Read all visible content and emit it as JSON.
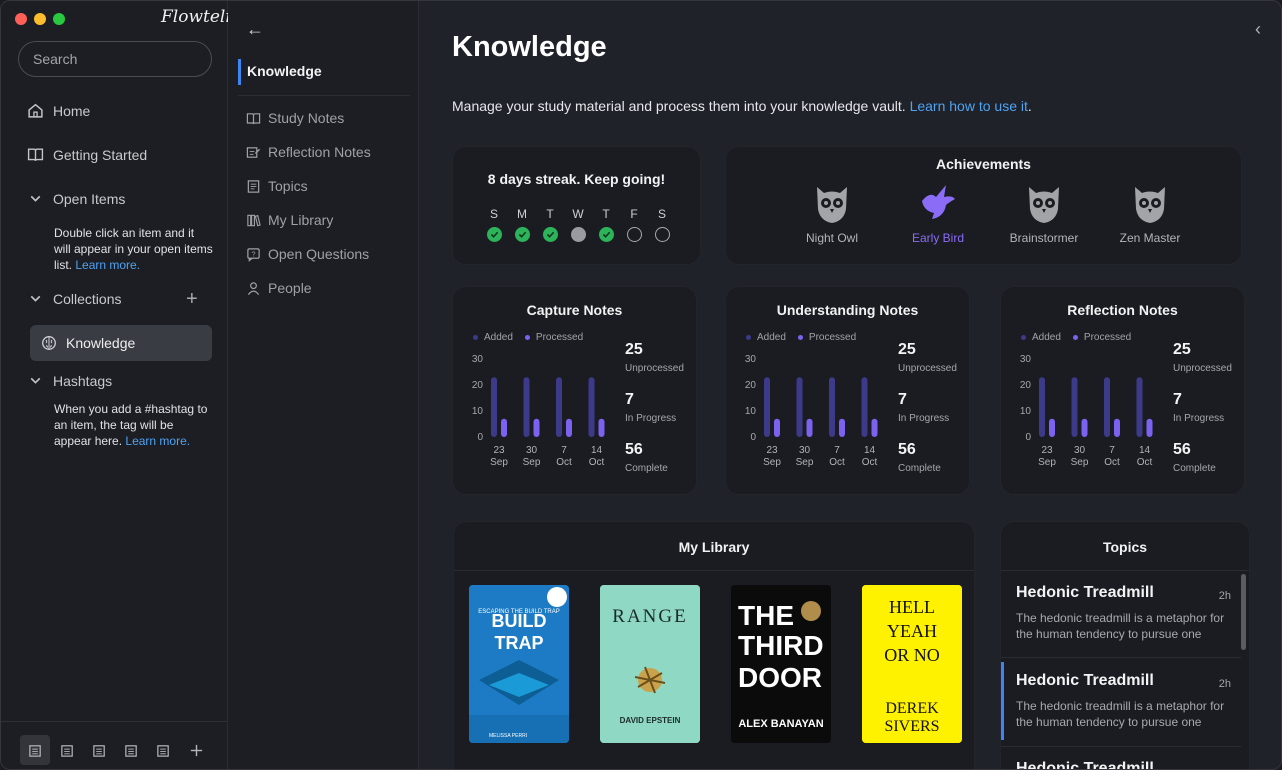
{
  "sidebar": {
    "logo": "Flowtelic",
    "search_placeholder": "Search",
    "items": {
      "home": "Home",
      "getting_started": "Getting Started",
      "open_items": "Open Items",
      "collections": "Collections",
      "knowledge": "Knowledge",
      "hashtags": "Hashtags"
    },
    "open_items_note": "Double click an item and it will appear in your open items list.",
    "hashtags_note": "When you add a #hashtag to an item, the tag will be appear here.",
    "learn_more": "Learn more.",
    "traffic_colors": [
      "#fe5f57",
      "#febc2e",
      "#28c840"
    ]
  },
  "subnav": {
    "active": "Knowledge",
    "items": [
      "Study Notes",
      "Reflection Notes",
      "Topics",
      "My Library",
      "Open Questions",
      "People"
    ]
  },
  "main": {
    "title": "Knowledge",
    "description": "Manage your study material and process them into your knowledge vault. ",
    "learn_link": "Learn how to use it",
    "period": ".",
    "streak": {
      "title": "8 days streak. Keep going!",
      "days": [
        {
          "label": "S",
          "state": "done"
        },
        {
          "label": "M",
          "state": "done"
        },
        {
          "label": "T",
          "state": "done"
        },
        {
          "label": "W",
          "state": "missed"
        },
        {
          "label": "T",
          "state": "done"
        },
        {
          "label": "F",
          "state": "empty"
        },
        {
          "label": "S",
          "state": "empty"
        }
      ]
    },
    "achievements": {
      "title": "Achievements",
      "items": [
        {
          "label": "Night Owl",
          "active": false
        },
        {
          "label": "Early Bird",
          "active": true
        },
        {
          "label": "Brainstormer",
          "active": false
        },
        {
          "label": "Zen Master",
          "active": false
        }
      ]
    },
    "library": {
      "title": "My Library",
      "books": [
        {
          "title": "ESCAPING THE BUILD TRAP",
          "author": "MELISSA PERRI",
          "color": "#1f7fc6"
        },
        {
          "title": "RANGE",
          "author": "DAVID EPSTEIN",
          "color": "#8ed8c4"
        },
        {
          "title": "THE THIRD DOOR",
          "author": "ALEX BANAYAN",
          "color": "#0b0b0b"
        },
        {
          "title": "HELL YEAH OR NO",
          "author": "DEREK SIVERS",
          "color": "#fff200"
        }
      ]
    },
    "topics": {
      "title": "Topics",
      "items": [
        {
          "title": "Hedonic Treadmill",
          "time": "2h",
          "desc": "The hedonic treadmill is a metaphor for the human tendency to pursue one"
        },
        {
          "title": "Hedonic Treadmill",
          "time": "2h",
          "desc": "The hedonic treadmill is a metaphor for the human tendency to pursue one"
        },
        {
          "title": "Hedonic Treadmill",
          "time": "",
          "desc": ""
        }
      ]
    }
  },
  "chart_data": [
    {
      "type": "bar",
      "title": "Capture Notes",
      "categories": [
        "23 Sep",
        "30 Sep",
        "7 Oct",
        "14 Oct"
      ],
      "series": [
        {
          "name": "Added",
          "values": [
            23,
            23,
            23,
            23
          ]
        },
        {
          "name": "Processed",
          "values": [
            7,
            7,
            7,
            7
          ]
        }
      ],
      "ylim": [
        0,
        30
      ],
      "yticks": [
        0,
        10,
        20,
        30
      ],
      "stats": [
        {
          "value": "25",
          "label": "Unprocessed"
        },
        {
          "value": "7",
          "label": "In Progress"
        },
        {
          "value": "56",
          "label": "Complete"
        }
      ]
    },
    {
      "type": "bar",
      "title": "Understanding Notes",
      "categories": [
        "23 Sep",
        "30 Sep",
        "7 Oct",
        "14 Oct"
      ],
      "series": [
        {
          "name": "Added",
          "values": [
            23,
            23,
            23,
            23
          ]
        },
        {
          "name": "Processed",
          "values": [
            7,
            7,
            7,
            7
          ]
        }
      ],
      "ylim": [
        0,
        30
      ],
      "yticks": [
        0,
        10,
        20,
        30
      ],
      "stats": [
        {
          "value": "25",
          "label": "Unprocessed"
        },
        {
          "value": "7",
          "label": "In Progress"
        },
        {
          "value": "56",
          "label": "Complete"
        }
      ]
    },
    {
      "type": "bar",
      "title": "Reflection Notes",
      "categories": [
        "23 Sep",
        "30 Sep",
        "7 Oct",
        "14 Oct"
      ],
      "series": [
        {
          "name": "Added",
          "values": [
            23,
            23,
            23,
            23
          ]
        },
        {
          "name": "Processed",
          "values": [
            7,
            7,
            7,
            7
          ]
        }
      ],
      "ylim": [
        0,
        30
      ],
      "yticks": [
        0,
        10,
        20,
        30
      ],
      "stats": [
        {
          "value": "25",
          "label": "Unprocessed"
        },
        {
          "value": "7",
          "label": "In Progress"
        },
        {
          "value": "56",
          "label": "Complete"
        }
      ]
    }
  ]
}
